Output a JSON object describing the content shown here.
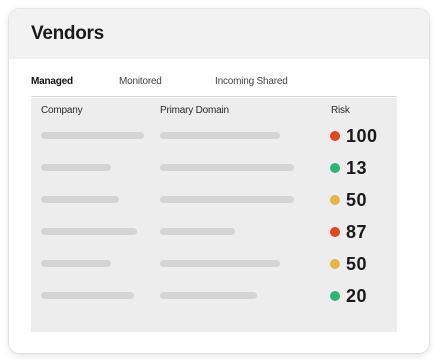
{
  "card": {
    "title": "Vendors"
  },
  "tabs": [
    {
      "label": "Managed",
      "active": true
    },
    {
      "label": "Monitored",
      "active": false
    },
    {
      "label": "Incoming Shared",
      "active": false
    }
  ],
  "table": {
    "headers": {
      "company": "Company",
      "domain": "Primary Domain",
      "risk": "Risk"
    },
    "rows": [
      {
        "risk": "100",
        "status": "red"
      },
      {
        "risk": "13",
        "status": "green"
      },
      {
        "risk": "50",
        "status": "yellow"
      },
      {
        "risk": "87",
        "status": "red"
      },
      {
        "risk": "50",
        "status": "yellow"
      },
      {
        "risk": "20",
        "status": "green"
      }
    ]
  },
  "colors": {
    "red": "#e0471f",
    "green": "#2bb57a",
    "yellow": "#e5b547",
    "placeholder": "#d4d4d4"
  }
}
